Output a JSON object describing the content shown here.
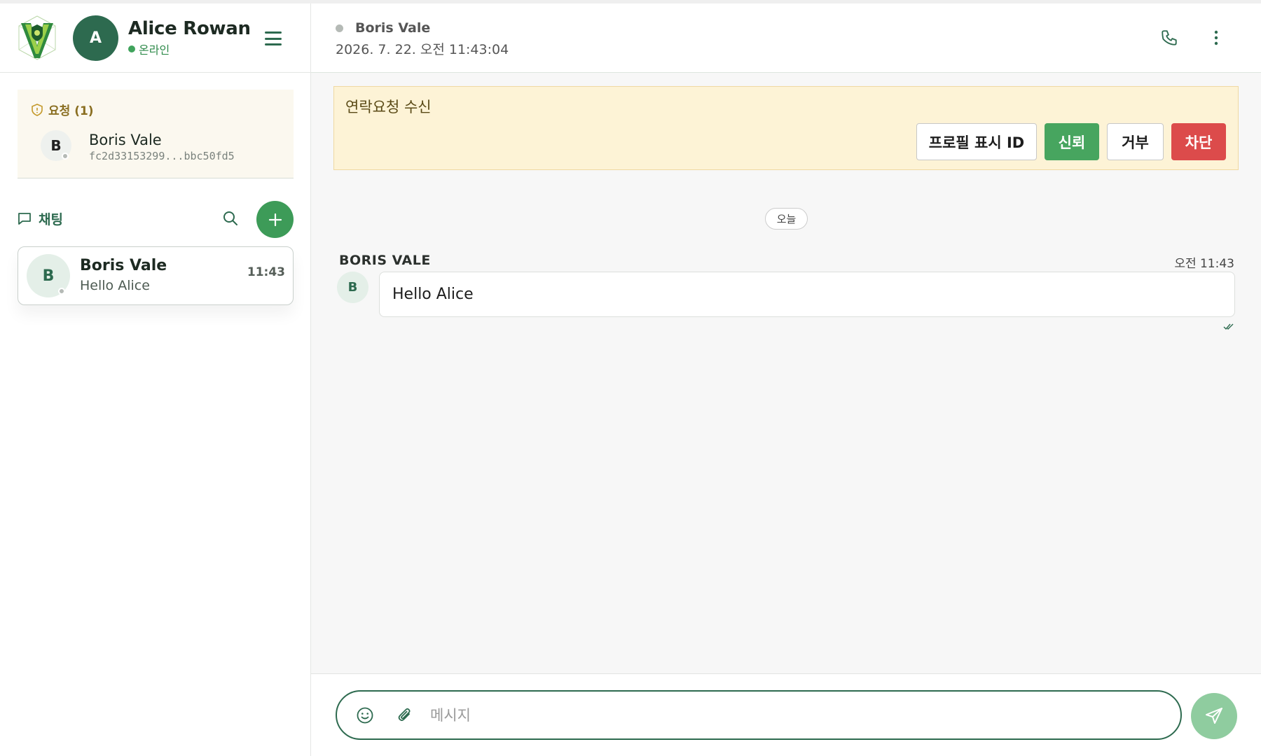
{
  "user": {
    "name": "Alice Rowan",
    "initial": "A",
    "status": "온라인"
  },
  "requests": {
    "title": "요청 (1)",
    "items": [
      {
        "initial": "B",
        "name": "Boris Vale",
        "id": "fc2d33153299...bbc50fd5"
      }
    ]
  },
  "chats": {
    "title": "채팅",
    "items": [
      {
        "initial": "B",
        "name": "Boris Vale",
        "preview": "Hello Alice",
        "time": "11:43"
      }
    ]
  },
  "conversation": {
    "peer_name": "Boris Vale",
    "peer_timestamp": "2026. 7. 22. 오전 11:43:04",
    "banner": {
      "title": "연락요청 수신",
      "buttons": {
        "profile": "프로필 표시 ID",
        "trust": "신뢰",
        "reject": "거부",
        "block": "차단"
      }
    },
    "day_label": "오늘",
    "messages": [
      {
        "sender": "BORIS VALE",
        "initial": "B",
        "time": "오전 11:43",
        "text": "Hello Alice",
        "read": true
      }
    ]
  },
  "composer": {
    "placeholder": "메시지"
  },
  "colors": {
    "brand": "#2d6a4f",
    "accent": "#47a55f",
    "danger": "#dc4b4b",
    "banner_bg": "#fdf3d6"
  },
  "icons": [
    "logo-icon",
    "menu-icon",
    "shield-icon",
    "chat-bubble-icon",
    "search-icon",
    "plus-icon",
    "phone-icon",
    "more-vertical-icon",
    "double-check-icon",
    "emoji-icon",
    "paperclip-icon",
    "send-icon"
  ]
}
